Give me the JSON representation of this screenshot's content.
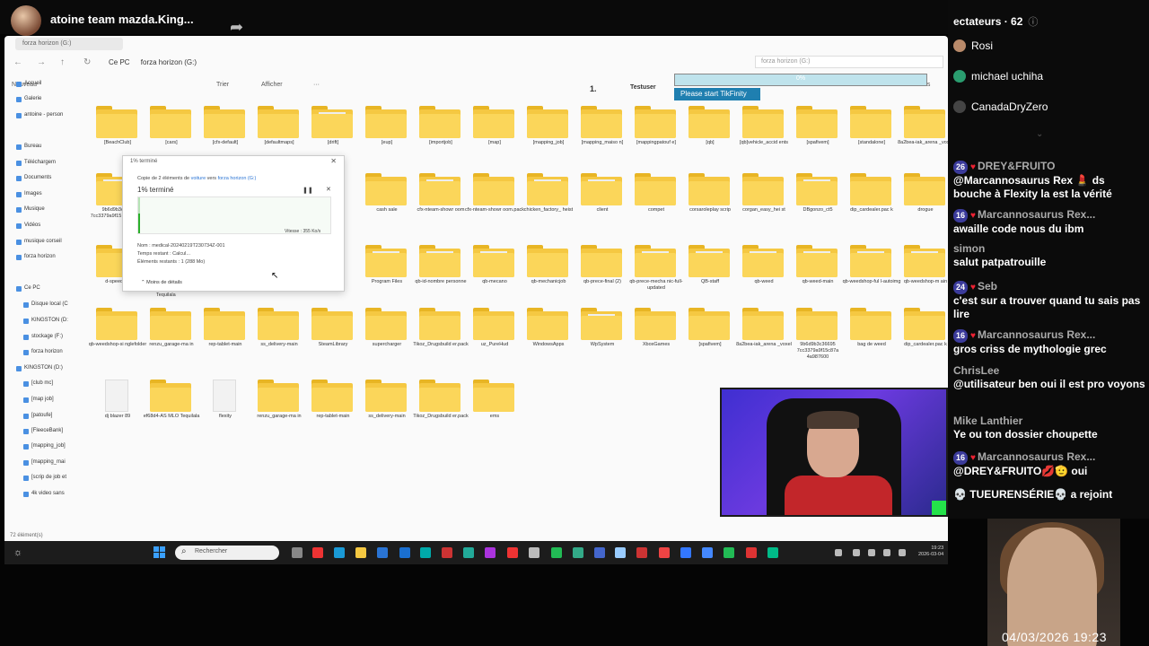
{
  "stream": {
    "streamer_name": "atoine team mazda.King..."
  },
  "explorer": {
    "tab_title": "forza horizon (G:)",
    "breadcrumb": [
      "Ce PC",
      "forza horizon (G:)"
    ],
    "search_placeholder": "forza horizon (G:)",
    "commands": {
      "new": "Nouveau",
      "sort": "Trier",
      "view": "Afficher",
      "more": "···",
      "details": "Détails"
    },
    "nav_items": [
      "Accueil",
      "Galerie",
      "antoine - person",
      "Bureau",
      "Téléchargem",
      "Documents",
      "Images",
      "Musique",
      "Vidéos",
      "musique corseil",
      "forza horizon",
      "Ce PC",
      "Disque local (C",
      "KINGSTON (D:",
      "stockage (F:)",
      "forza horizon",
      "KINGSTON (D:)",
      "[club mc]",
      "[map job]",
      "[patoufe]",
      "[FleeceBank]",
      "[mapping_job]",
      "[mapping_mai",
      "[scrip de job et",
      "4k video sans"
    ],
    "status": "72 élément(s)",
    "folders": [
      "[BeachClub]",
      "[cars]",
      "[cfx-default]",
      "[defaultmaps]",
      "[drift]",
      "[eup]",
      "[importjob]",
      "[map]",
      "[mapping_job]",
      "[mapping_maiso n]",
      "[mappingpatouf e]",
      "[qb]",
      "[qb]vehicle_accid ents",
      "[spafivem]",
      "[standalone]",
      "8a2bea-iak_arena _voxel",
      "9b6d9b3c3f68 7cc3379a9f15 4e987600",
      "",
      "",
      "",
      "",
      "cash sale",
      "cfx-nteam-showr oom",
      "cfx-nteam-showr oom.pack",
      "chicken_factory_ heist",
      "client",
      "compet",
      "corsaroleplay scrip",
      "corgan_easy_hei st",
      "DBgonzo_ct5",
      "dip_cardealer.pac k",
      "drogue",
      "d-speedom",
      "",
      "",
      "",
      "",
      "Program Files",
      "qb-id-nombre personne",
      "qb-mecano",
      "qb-mechanicjob",
      "qb-prece-final (2)",
      "qb-prece-mecha nic-full-updated",
      "QB-staff",
      "qb-weed",
      "qb-weed-main",
      "qb-weedshop-ful l-autoimg",
      "qb-weedshop-m ain",
      "qb-weedshop-si nglefolder",
      "renzu_garage-ma in",
      "rep-tablet-main",
      "ss_delivery-main",
      "SteamLibrary",
      "supercharger",
      "Tikoz_Drugsbuild er.pack",
      "uz_PureHud",
      "WindowsApps",
      "WpSystem",
      "XboxGames",
      "[spafivem]",
      "8a2bea-iak_arena _voxel",
      "9b6d9b3c36695 7cc3379a9f15c87a 4a987600",
      "bag de weed",
      "dip_cardealer.pac k",
      "dj blazer 89",
      "ef68d4-AS MLO Tequilala",
      "flexity",
      "renzu_garage-ma in",
      "rep-tablet-main",
      "ss_delivery-main",
      "Tikoz_Drugsbuild er.pack",
      "ems"
    ]
  },
  "copy_dialog": {
    "title": "1% terminé",
    "line_prefix": "Copie de 2 éléments de ",
    "line_from": "voiture",
    "line_mid": " vers ",
    "line_to": "forza horizon (G:)",
    "percent_label": "1% terminé",
    "progress_fraction": 0.01,
    "speed": "Vitesse : 355 Ko/s",
    "name": "Nom : medical-20240219T230734Z-001",
    "remaining_time": "Temps restant : Calcul...",
    "remaining_items": "Éléments restants : 1 (288 Mo)",
    "less_details": "Moins de détails",
    "folder_behind": "Tequilala"
  },
  "tikfinity": {
    "step": "1.",
    "user": "Testuser",
    "progress_text": "0%",
    "progress_fraction": 0.0,
    "start_button": "Please start TikFinity"
  },
  "taskbar": {
    "search": "Rechercher",
    "time": "19:23",
    "date": "2026-03-04"
  },
  "chat": {
    "viewers_label": "ectateurs · 62",
    "top_users": [
      "Rosi",
      "michael uchiha",
      "CanadaDryZero"
    ],
    "messages": [
      {
        "badge": "26",
        "user": "DREY&FRUITO",
        "text": "@Marcannosaurus Rex 💄 ds bouche à Flexity la est la vérité"
      },
      {
        "badge": "16",
        "user": "Marcannosaurus Rex...",
        "text": "awaille code nous du ibm"
      },
      {
        "badge": "",
        "user": "simon",
        "text": "salut patpatrouille"
      },
      {
        "badge": "24",
        "user": "Seb",
        "text": "c'est sur a trouver quand tu sais pas lire"
      },
      {
        "badge": "16",
        "user": "Marcannosaurus Rex...",
        "text": "gros criss de mythologie grec"
      },
      {
        "badge": "",
        "user": "ChrisLee",
        "text": "@utilisateur ben oui il est pro voyons"
      },
      {
        "badge": "",
        "user": "Mike Lanthier",
        "text": "Ye ou ton dossier choupette"
      },
      {
        "badge": "16",
        "user": "Marcannosaurus Rex...",
        "text": "@DREY&FRUITO💋🫡 oui"
      }
    ],
    "join_text": "💀 TUEURENSÉRIE💀  a rejoint"
  },
  "overlay": {
    "timestamp": "04/03/2026 19:23"
  }
}
